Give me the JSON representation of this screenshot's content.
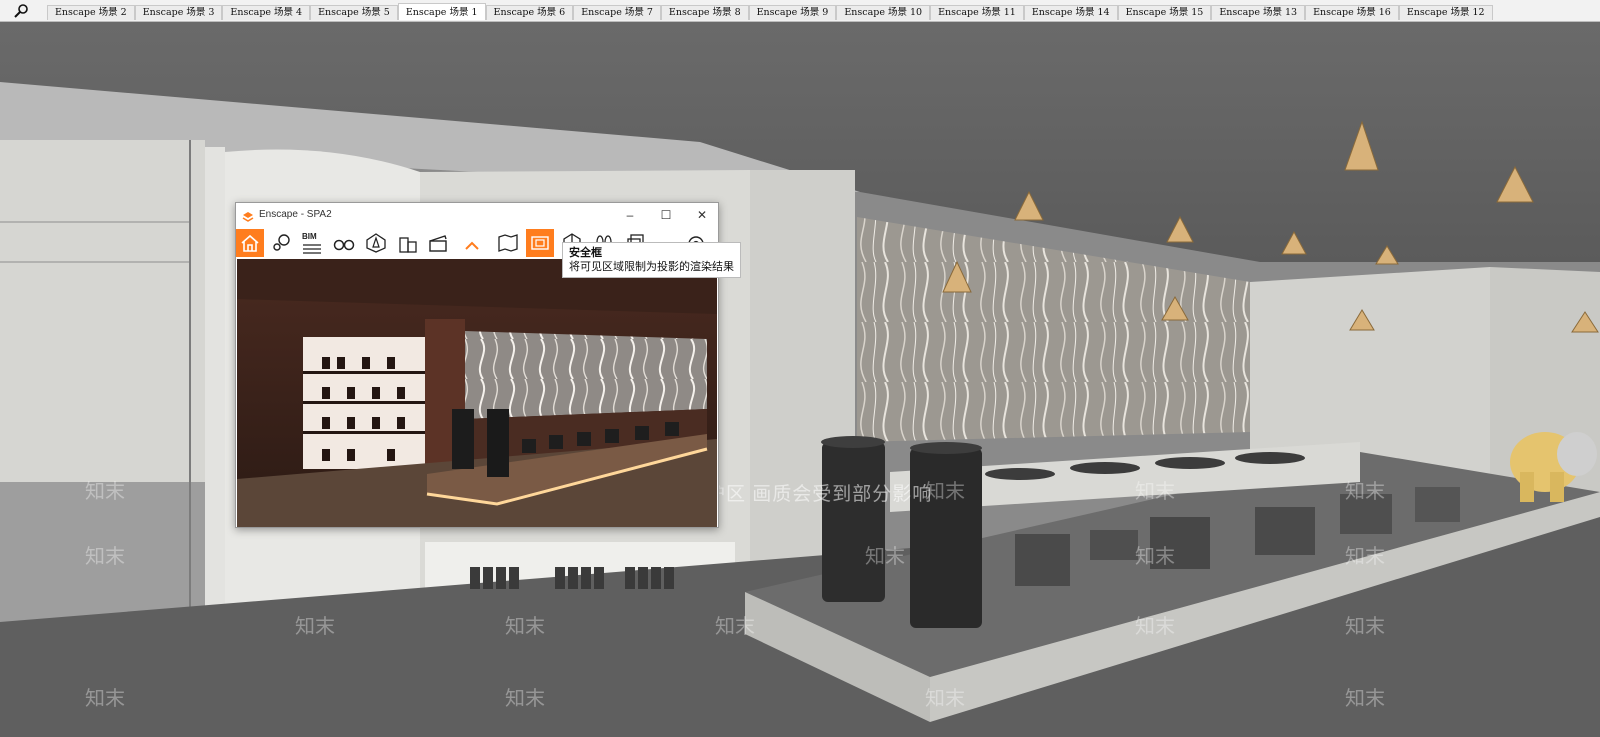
{
  "tabbar": {
    "tabs": [
      {
        "label": "Enscape 场景 2",
        "active": false
      },
      {
        "label": "Enscape 场景 3",
        "active": false
      },
      {
        "label": "Enscape 场景 4",
        "active": false
      },
      {
        "label": "Enscape 场景 5",
        "active": false
      },
      {
        "label": "Enscape 场景 1",
        "active": true
      },
      {
        "label": "Enscape 场景 6",
        "active": false
      },
      {
        "label": "Enscape 场景 7",
        "active": false
      },
      {
        "label": "Enscape 场景 8",
        "active": false
      },
      {
        "label": "Enscape 场景 9",
        "active": false
      },
      {
        "label": "Enscape 场景 10",
        "active": false
      },
      {
        "label": "Enscape 场景 11",
        "active": false
      },
      {
        "label": "Enscape 场景 14",
        "active": false
      },
      {
        "label": "Enscape 场景 15",
        "active": false
      },
      {
        "label": "Enscape 场景 13",
        "active": false
      },
      {
        "label": "Enscape 场景 16",
        "active": false
      },
      {
        "label": "Enscape 场景 12",
        "active": false
      }
    ]
  },
  "enscape": {
    "title": "Enscape - SPA2",
    "accent": "#ff7d1e",
    "bim_label": "BIM",
    "toolbar_icons": [
      "home-icon",
      "map-pin-icon",
      "bim-icon",
      "binoculars-icon",
      "compass-icon",
      "buildings-icon",
      "clapper-icon",
      "chevron-up-icon",
      "map-icon",
      "safe-frame-icon",
      "cube-icon",
      "footprints-icon",
      "copy-icon",
      "settings-icon"
    ]
  },
  "tooltip": {
    "title": "安全框",
    "body": "将可见区域限制为投影的渲染结果"
  },
  "watermark": {
    "main": "水印保护区  画质会受到部分影响",
    "brand": "知末"
  }
}
